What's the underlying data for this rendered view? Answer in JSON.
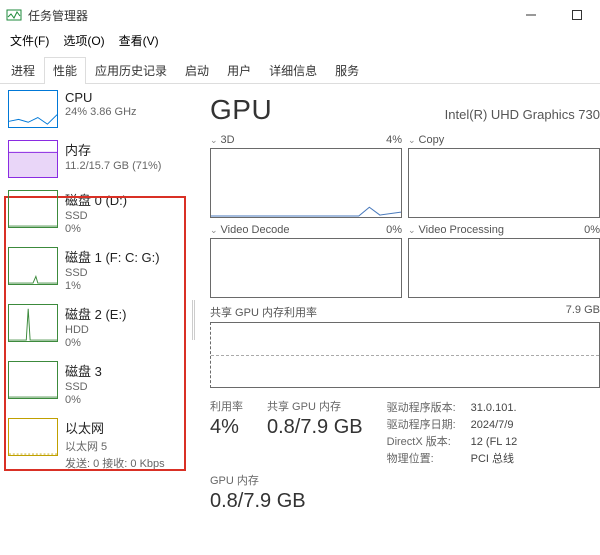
{
  "window": {
    "title": "任务管理器"
  },
  "menus": {
    "file": "文件(F)",
    "options": "选项(O)",
    "view": "查看(V)"
  },
  "tabs": {
    "processes": "进程",
    "performance": "性能",
    "app_history": "应用历史记录",
    "startup": "启动",
    "users": "用户",
    "details": "详细信息",
    "services": "服务"
  },
  "sidebar": {
    "cpu": {
      "title": "CPU",
      "sub": "24%  3.86 GHz"
    },
    "memory": {
      "title": "内存",
      "sub": "11.2/15.7 GB (71%)"
    },
    "disk0": {
      "title": "磁盘 0 (D:)",
      "sub": "SSD",
      "val": "0%"
    },
    "disk1": {
      "title": "磁盘 1 (F: C: G:)",
      "sub": "SSD",
      "val": "1%"
    },
    "disk2": {
      "title": "磁盘 2 (E:)",
      "sub": "HDD",
      "val": "0%"
    },
    "disk3": {
      "title": "磁盘 3",
      "sub": "SSD",
      "val": "0%"
    },
    "ethernet": {
      "title": "以太网",
      "sub": "以太网 5",
      "val": "发送: 0  接收: 0 Kbps"
    }
  },
  "detail": {
    "title": "GPU",
    "subtitle": "Intel(R) UHD Graphics 730",
    "charts": {
      "c3d": {
        "label": "3D",
        "percent": "4%"
      },
      "copy": {
        "label": "Copy",
        "percent": ""
      },
      "decode": {
        "label": "Video Decode",
        "percent": "0%"
      },
      "process": {
        "label": "Video Processing",
        "percent": "0%"
      }
    },
    "shared": {
      "label": "共享 GPU 内存利用率",
      "right": "7.9 GB"
    },
    "stats": {
      "util_label": "利用率",
      "util_value": "4%",
      "shared_label": "共享 GPU 内存",
      "shared_value": "0.8/7.9 GB",
      "gpumem_label": "GPU 内存",
      "gpumem_value": "0.8/7.9 GB"
    },
    "info": {
      "driver_ver_k": "驱动程序版本:",
      "driver_ver_v": "31.0.101.",
      "driver_date_k": "驱动程序日期:",
      "driver_date_v": "2024/7/9",
      "directx_k": "DirectX 版本:",
      "directx_v": "12 (FL 12",
      "loc_k": "物理位置:",
      "loc_v": "PCI 总线"
    }
  },
  "chart_data": {
    "type": "line",
    "engines": [
      {
        "name": "3D",
        "percent": 4
      },
      {
        "name": "Copy",
        "percent": 0
      },
      {
        "name": "Video Decode",
        "percent": 0
      },
      {
        "name": "Video Processing",
        "percent": 0
      }
    ],
    "shared_gpu_memory": {
      "used_gb": 0.8,
      "total_gb": 7.9,
      "ylim": [
        0,
        7.9
      ]
    },
    "gpu_memory": {
      "used_gb": 0.8,
      "total_gb": 7.9
    },
    "utilization_percent": 4,
    "title": "GPU",
    "ylim": [
      0,
      100
    ]
  }
}
